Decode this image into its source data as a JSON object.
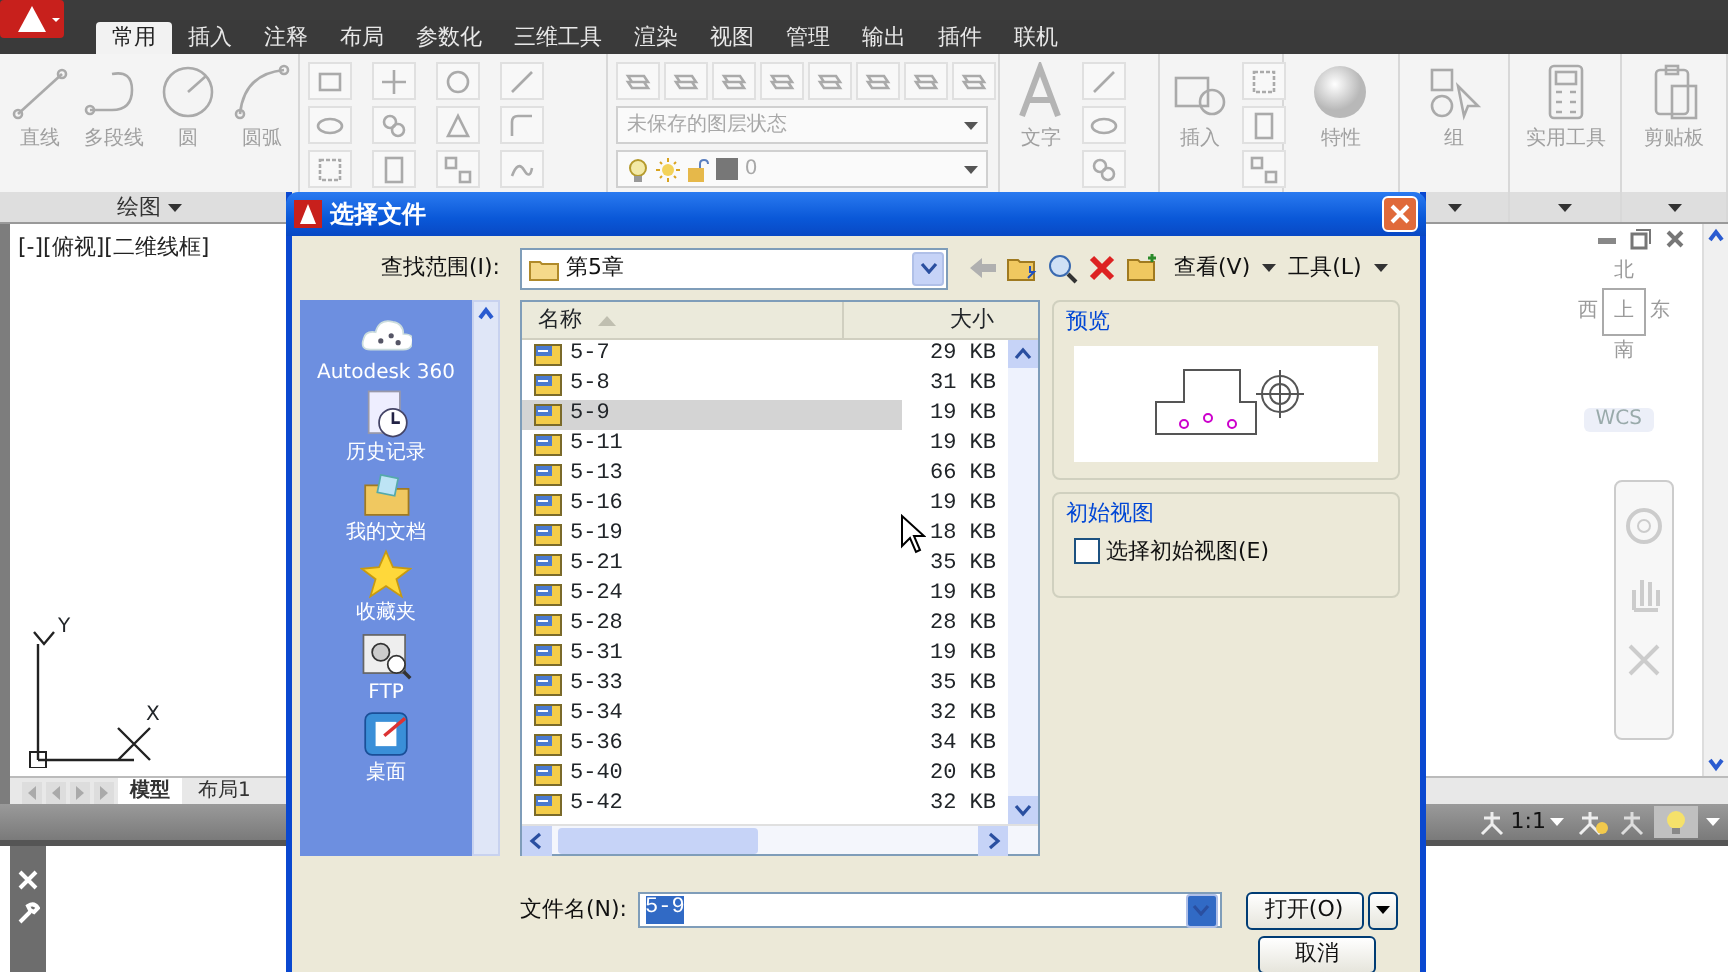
{
  "ribbon": {
    "tabs": [
      {
        "label": "常用",
        "selected": true
      },
      {
        "label": "插入",
        "selected": false
      },
      {
        "label": "注释",
        "selected": false
      },
      {
        "label": "布局",
        "selected": false
      },
      {
        "label": "参数化",
        "selected": false
      },
      {
        "label": "三维工具",
        "selected": false
      },
      {
        "label": "渲染",
        "selected": false
      },
      {
        "label": "视图",
        "selected": false
      },
      {
        "label": "管理",
        "selected": false
      },
      {
        "label": "输出",
        "selected": false
      },
      {
        "label": "插件",
        "selected": false
      },
      {
        "label": "联机",
        "selected": false
      }
    ],
    "draw_tools": [
      {
        "label": "直线",
        "kind": "line"
      },
      {
        "label": "多段线",
        "kind": "polyline"
      },
      {
        "label": "圆",
        "kind": "circle"
      },
      {
        "label": "圆弧",
        "kind": "arc"
      }
    ],
    "draw_panel_title": "绘图",
    "layer_state": "未保存的图层状态",
    "current_layer": "0",
    "large_tools": [
      {
        "label": "文字",
        "kind": "text"
      },
      {
        "label": "插入",
        "kind": "insert"
      },
      {
        "label": "特性",
        "kind": "properties"
      },
      {
        "label": "组",
        "kind": "group"
      },
      {
        "label": "实用工具",
        "kind": "utilities"
      },
      {
        "label": "剪贴板",
        "kind": "clipboard"
      }
    ]
  },
  "viewport": {
    "label": "[-][俯视][二维线框]",
    "viewcube": {
      "north": "北",
      "west": "西",
      "top": "上",
      "east": "东",
      "south": "南",
      "ucs": "WCS"
    },
    "ucs_axes": {
      "y": "Y",
      "x": "X"
    }
  },
  "layout_tabs": [
    {
      "label": "模型",
      "selected": true
    },
    {
      "label": "布局1",
      "selected": false
    }
  ],
  "status_bar": {
    "annotation_scale": "1:1"
  },
  "dialog": {
    "title": "选择文件",
    "look_in_label": "查找范围(I):",
    "look_in": "第5章",
    "view_menu": "查看(V)",
    "tools_menu": "工具(L)",
    "places": [
      {
        "label": "Autodesk 360",
        "kind": "cloud"
      },
      {
        "label": "历史记录",
        "kind": "history"
      },
      {
        "label": "我的文档",
        "kind": "documents"
      },
      {
        "label": "收藏夹",
        "kind": "favorites"
      },
      {
        "label": "FTP",
        "kind": "ftp"
      },
      {
        "label": "桌面",
        "kind": "desktop"
      }
    ],
    "columns": [
      "名称",
      "大小"
    ],
    "files": [
      {
        "name": "5-7",
        "size": "29 KB",
        "selected": false
      },
      {
        "name": "5-8",
        "size": "31 KB",
        "selected": false
      },
      {
        "name": "5-9",
        "size": "19 KB",
        "selected": true
      },
      {
        "name": "5-11",
        "size": "19 KB",
        "selected": false
      },
      {
        "name": "5-13",
        "size": "66 KB",
        "selected": false
      },
      {
        "name": "5-16",
        "size": "19 KB",
        "selected": false
      },
      {
        "name": "5-19",
        "size": "18 KB",
        "selected": false
      },
      {
        "name": "5-21",
        "size": "35 KB",
        "selected": false
      },
      {
        "name": "5-24",
        "size": "19 KB",
        "selected": false
      },
      {
        "name": "5-28",
        "size": "28 KB",
        "selected": false
      },
      {
        "name": "5-31",
        "size": "19 KB",
        "selected": false
      },
      {
        "name": "5-33",
        "size": "35 KB",
        "selected": false
      },
      {
        "name": "5-34",
        "size": "32 KB",
        "selected": false
      },
      {
        "name": "5-36",
        "size": "34 KB",
        "selected": false
      },
      {
        "name": "5-40",
        "size": "20 KB",
        "selected": false
      },
      {
        "name": "5-42",
        "size": "32 KB",
        "selected": false
      }
    ],
    "preview_label": "预览",
    "initial_view_label": "初始视图",
    "select_initial_view": {
      "label": "选择初始视图(E)",
      "checked": false
    },
    "file_name_label": "文件名(N):",
    "file_name": "5-9",
    "open_button": "打开(O)",
    "cancel_button": "取消"
  }
}
